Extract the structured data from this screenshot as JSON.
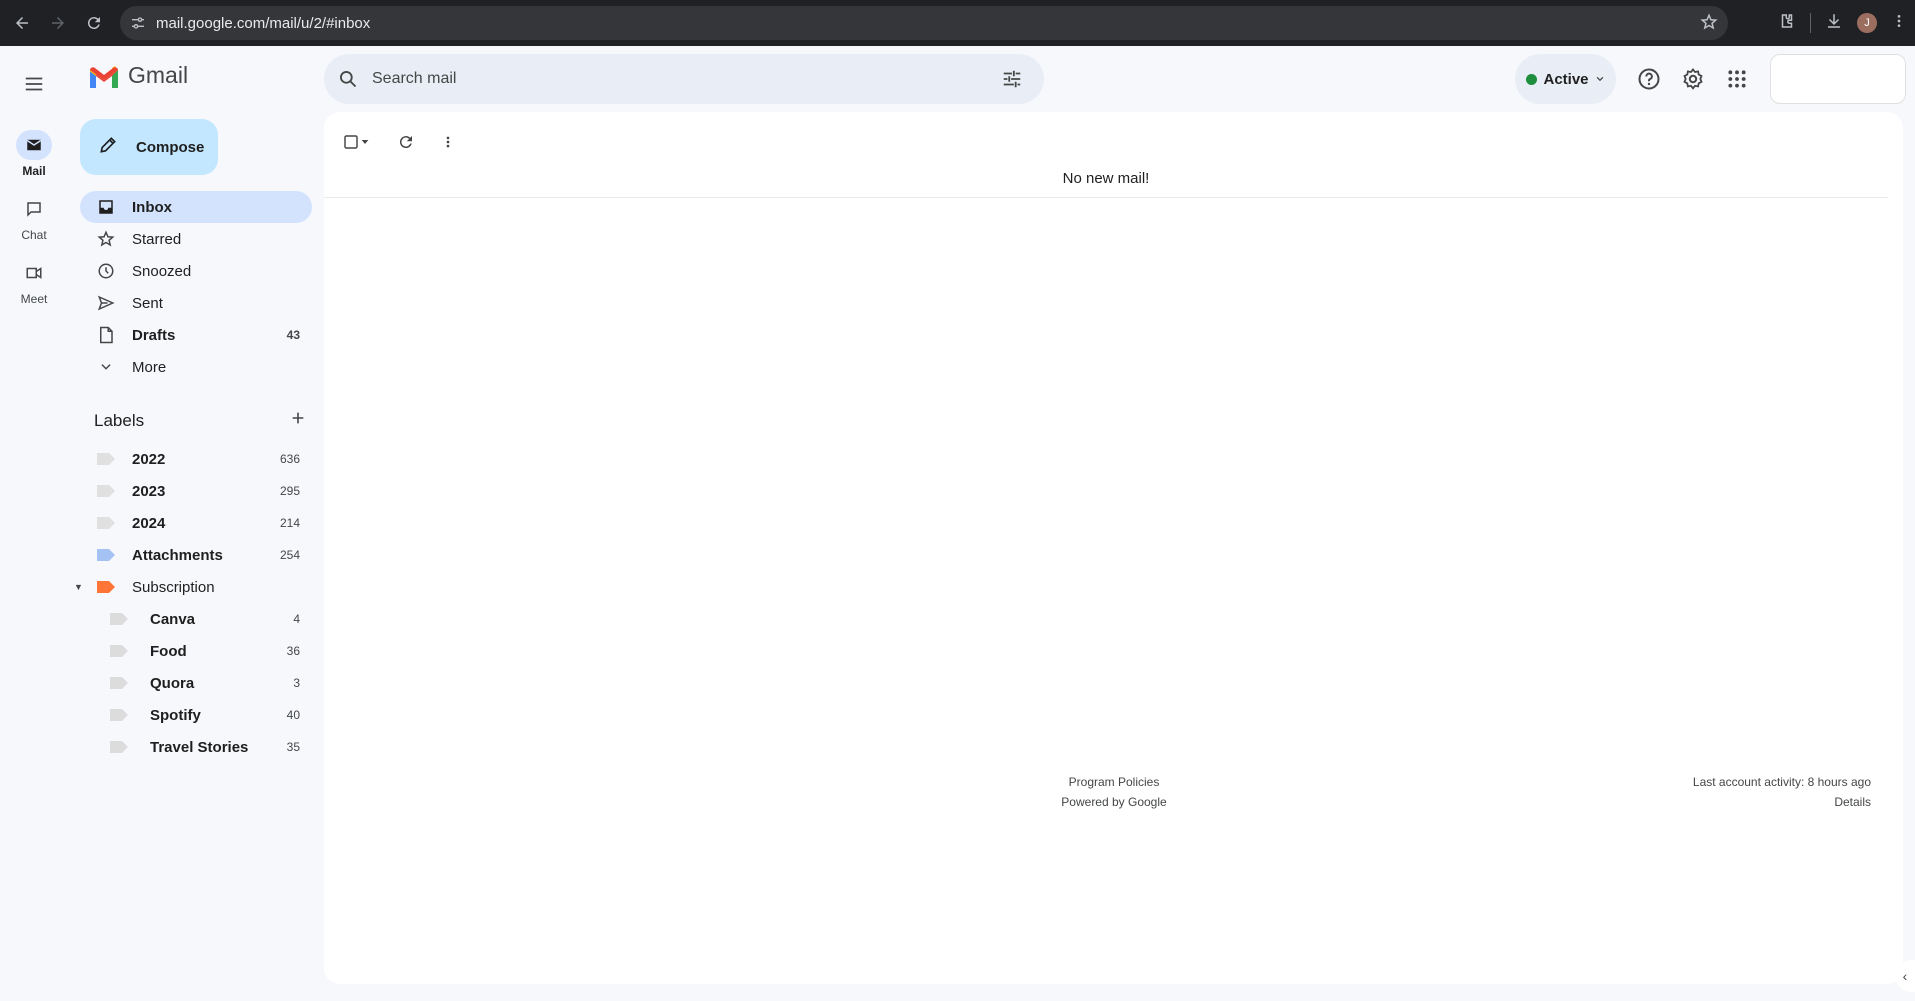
{
  "browser": {
    "url": "mail.google.com/mail/u/2/#inbox",
    "profile_initial": "J"
  },
  "rail": {
    "items": [
      {
        "label": "Mail",
        "icon": "mail-icon"
      },
      {
        "label": "Chat",
        "icon": "chat-icon"
      },
      {
        "label": "Meet",
        "icon": "meet-icon"
      }
    ]
  },
  "header": {
    "app_name": "Gmail",
    "search_placeholder": "Search mail",
    "status_label": "Active"
  },
  "compose_label": "Compose",
  "nav": [
    {
      "label": "Inbox",
      "count": ""
    },
    {
      "label": "Starred",
      "count": ""
    },
    {
      "label": "Snoozed",
      "count": ""
    },
    {
      "label": "Sent",
      "count": ""
    },
    {
      "label": "Drafts",
      "count": "43"
    },
    {
      "label": "More",
      "count": ""
    }
  ],
  "labels_heading": "Labels",
  "labels": [
    {
      "name": "2022",
      "count": "636",
      "color": "#e0e0e0"
    },
    {
      "name": "2023",
      "count": "295",
      "color": "#e0e0e0"
    },
    {
      "name": "2024",
      "count": "214",
      "color": "#e0e0e0"
    },
    {
      "name": "Attachments",
      "count": "254",
      "color": "#a4c2f4"
    },
    {
      "name": "Subscription",
      "count": "",
      "color": "#ff7537"
    },
    {
      "name": "Canva",
      "count": "4",
      "color": "#dcdcdc"
    },
    {
      "name": "Food",
      "count": "36",
      "color": "#dcdcdc"
    },
    {
      "name": "Quora",
      "count": "3",
      "color": "#dcdcdc"
    },
    {
      "name": "Spotify",
      "count": "40",
      "color": "#dcdcdc"
    },
    {
      "name": "Travel Stories",
      "count": "35",
      "color": "#dcdcdc"
    }
  ],
  "main": {
    "empty_message": "No new mail!",
    "footer_links": [
      "Program Policies",
      "Powered by Google"
    ],
    "activity": "Last account activity: 8 hours ago",
    "details_link": "Details"
  }
}
